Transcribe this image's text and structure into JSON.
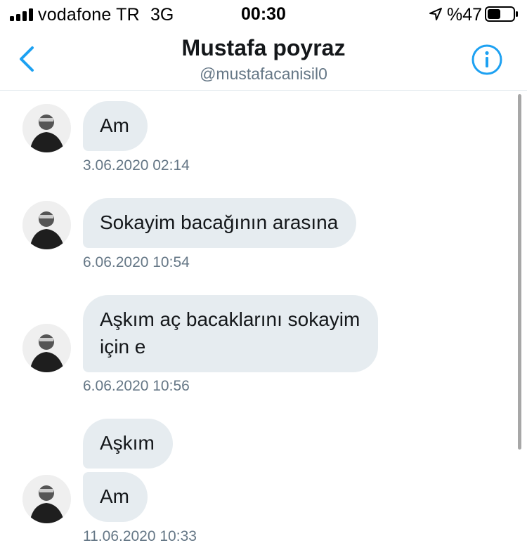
{
  "status_bar": {
    "carrier": "vodafone TR",
    "network": "3G",
    "time": "00:30",
    "battery": "%47",
    "battery_level": 0.47
  },
  "header": {
    "title": "Mustafa poyraz",
    "handle": "@mustafacanisil0",
    "back_icon": "chevron-left-icon",
    "info_icon": "info-circle-icon",
    "accent_color": "#1da1f2"
  },
  "messages": [
    {
      "text": "Am",
      "timestamp": "3.06.2020 02:14"
    },
    {
      "text": "Sokayim bacağının arasına",
      "timestamp": "6.06.2020 10:54"
    },
    {
      "text_lines": [
        "Aşkım aç bacaklarını sokayim",
        "için e"
      ],
      "timestamp": "6.06.2020 10:56"
    },
    {
      "texts": [
        "Aşkım",
        "Am"
      ],
      "timestamp": "11.06.2020 10:33"
    }
  ],
  "colors": {
    "bubble_bg": "#e6ecf0",
    "text": "#14171a",
    "secondary_text": "#657786"
  }
}
